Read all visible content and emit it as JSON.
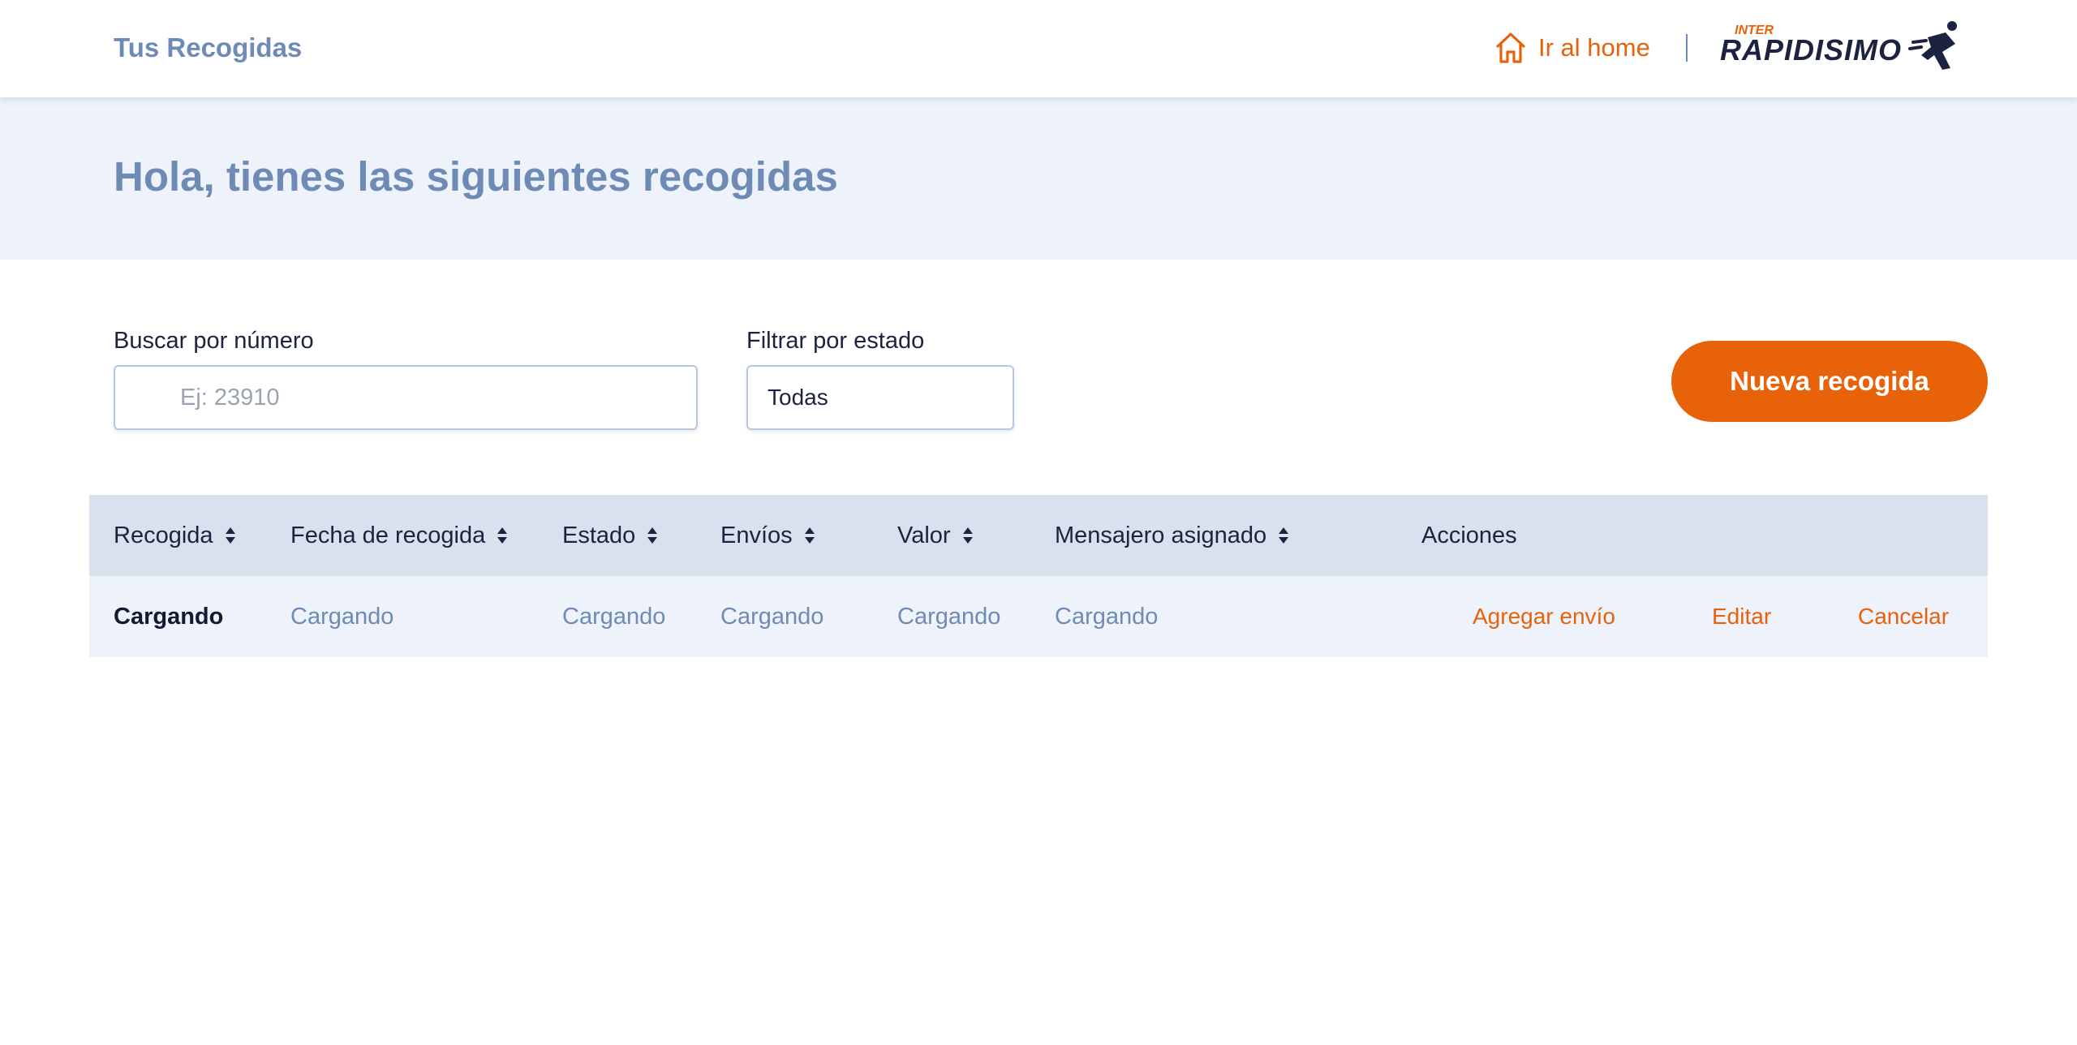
{
  "header": {
    "title": "Tus Recogidas",
    "home_link": "Ir al home",
    "logo_alt": "INTER RAPIDISIMO"
  },
  "banner": {
    "greeting": "Hola, tienes las siguientes recogidas"
  },
  "filters": {
    "search_label": "Buscar por número",
    "search_placeholder": "Ej: 23910",
    "status_label": "Filtrar por estado",
    "status_value": "Todas",
    "new_button": "Nueva recogida"
  },
  "table": {
    "headers": [
      "Recogida",
      "Fecha de recogida",
      "Estado",
      "Envíos",
      "Valor",
      "Mensajero asignado",
      "Acciones"
    ],
    "rows": [
      {
        "recogida": "Cargando",
        "fecha": "Cargando",
        "estado": "Cargando",
        "envios": "Cargando",
        "valor": "Cargando",
        "mensajero": "Cargando",
        "actions": [
          "Agregar envío",
          "Editar",
          "Cancelar"
        ]
      }
    ]
  },
  "colors": {
    "accent": "#e8620a",
    "muted_blue": "#6e8bb5",
    "banner_bg": "#edf2fb",
    "table_header_bg": "#d9e0ee",
    "text_dark": "#1c2340"
  },
  "icons": {
    "home": "home-icon",
    "sort": "sort-icon"
  }
}
